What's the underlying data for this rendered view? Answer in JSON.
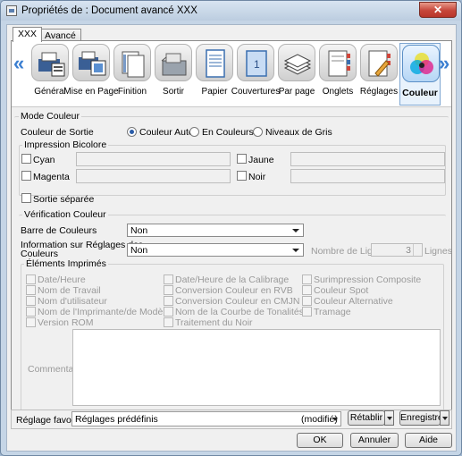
{
  "window": {
    "title": "Propriétés de : Document avancé XXX",
    "close_label": "✕"
  },
  "tabs": [
    {
      "label": "XXX"
    },
    {
      "label": "Avancé"
    }
  ],
  "toolbar": {
    "prev": "«",
    "next": "»",
    "items": [
      {
        "label": "Général",
        "icon": "printer-settings-icon"
      },
      {
        "label": "Mise en Page",
        "icon": "layout-icon"
      },
      {
        "label": "Finition",
        "icon": "finishing-icon"
      },
      {
        "label": "Sortir",
        "icon": "output-tray-icon"
      },
      {
        "label": "Papier",
        "icon": "paper-icon"
      },
      {
        "label": "Couvertures",
        "icon": "cover-icon"
      },
      {
        "label": "Par page",
        "icon": "paper-stack-icon"
      },
      {
        "label": "Onglets",
        "icon": "tab-sheets-icon"
      },
      {
        "label": "Réglages",
        "icon": "settings-sheet-icon"
      },
      {
        "label": "Couleur",
        "icon": "color-circles-icon"
      }
    ]
  },
  "color_mode": {
    "section": "Mode Couleur",
    "output_label": "Couleur de Sortie",
    "options": [
      "Couleur Auto",
      "En Couleurs",
      "Niveaux de Gris"
    ],
    "selected": "Couleur Auto"
  },
  "bicolor": {
    "section": "Impression Bicolore",
    "items": [
      "Cyan",
      "Magenta",
      "Jaune",
      "Noir"
    ],
    "separate_output": "Sortie séparée"
  },
  "verification": {
    "section": "Vérification Couleur",
    "bar_label": "Barre de Couleurs",
    "bar_value": "Non",
    "info_label_1": "Information sur Réglages des",
    "info_label_2": "Couleurs",
    "info_value": "Non",
    "lines_label": "Nombre de Lignes",
    "lines_value": "3",
    "lines_unit": "Lignes",
    "printed_section": "Éléments Imprimés",
    "col1": [
      "Date/Heure",
      "Nom de Travail",
      "Nom d'utilisateur",
      "Nom de l'Imprimante/de Modèle",
      "Version ROM"
    ],
    "col2": [
      "Date/Heure de la Calibrage",
      "Conversion Couleur en RVB",
      "Conversion Couleur en CMJN",
      "Nom de la Courbe de Tonalités",
      "Traitement du Noir"
    ],
    "col3": [
      "Surimpression Composite",
      "Couleur Spot",
      "Couleur Alternative",
      "Tramage"
    ],
    "comment_label": "Commentaire"
  },
  "favorites": {
    "label": "Réglage favori",
    "value": "Réglages prédéfinis",
    "modified": "(modifié)",
    "restore": "Rétablir",
    "save": "Enregistrer"
  },
  "dialog_buttons": {
    "ok": "OK",
    "cancel": "Annuler",
    "help": "Aide"
  }
}
